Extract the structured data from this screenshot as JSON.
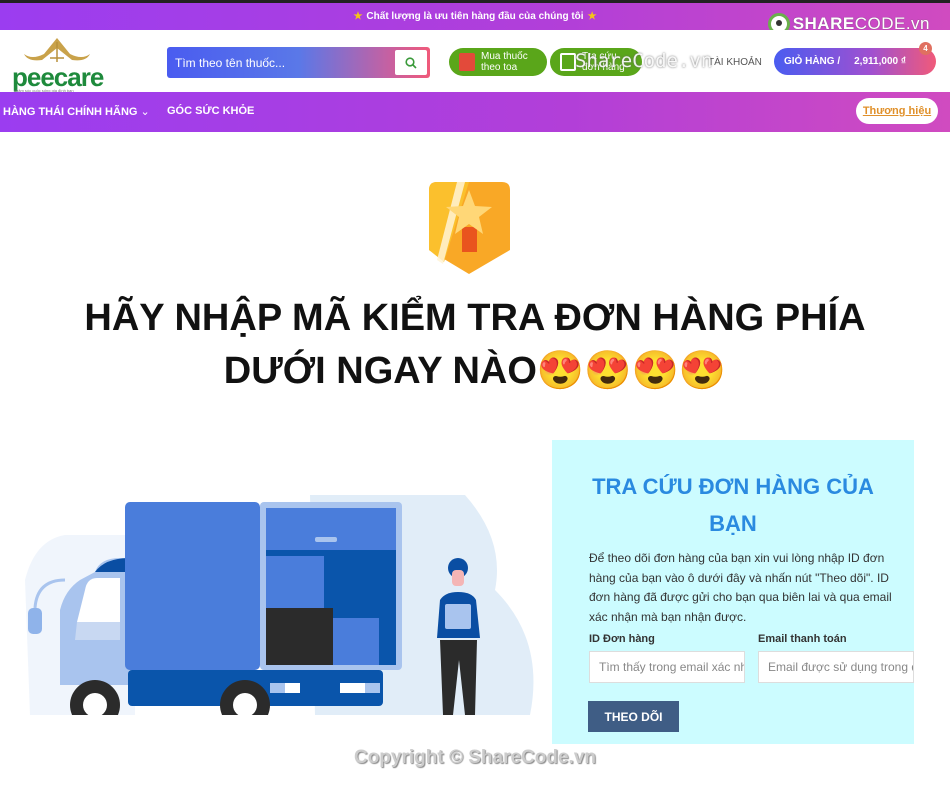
{
  "topbar": {
    "text": "Chất lượng là ưu tiên hàng đầu của chúng tôi"
  },
  "watermark": {
    "logo_text_bold": "SHARE",
    "logo_text_light": "CODE.vn",
    "center": "ShareCode.vn",
    "copyright": "Copyright © ShareCode.vn"
  },
  "header": {
    "logo_name": "peecare",
    "logo_tagline": "chăm sóc cuộc sống gia đình bạn",
    "search_placeholder": "Tìm theo tên thuốc...",
    "pill_prescription": [
      "Mua thuốc",
      "theo toa"
    ],
    "pill_lookup": [
      "Tra cứu",
      "đơn hàng"
    ],
    "account": "TÀI KHOẢN",
    "cart_label": "GIỎ HÀNG /",
    "cart_amount": "2,911,000 ₫",
    "cart_count": "4"
  },
  "nav": {
    "items": [
      {
        "label": "HÀNG THÁI CHÍNH HÃNG"
      },
      {
        "label": "GÓC SỨC KHỎE"
      }
    ],
    "brand_button": "Thương hiệu"
  },
  "main": {
    "headline_line1": "HÃY NHẬP MÃ KIỂM TRA ĐƠN HÀNG PHÍA",
    "headline_line2": "DƯỚI NGAY NÀO",
    "emojis": "😍😍😍😍"
  },
  "tracking": {
    "title": "TRA CỨU ĐƠN HÀNG CỦA BẠN",
    "description": "Để theo dõi đơn hàng của bạn xin vui lòng nhập ID đơn hàng của bạn vào ô dưới đây và nhấn nút \"Theo dõi\". ID đơn hàng đã được gửi cho bạn qua biên lai và qua email xác nhận mà bạn nhận được.",
    "order_id_label": "ID Đơn hàng",
    "order_id_placeholder": "Tìm thấy trong email xác nhận đơn hàng.",
    "email_label": "Email thanh toán",
    "email_placeholder": "Email được sử dụng trong quá trình thanh toán.",
    "submit": "THEO DÕI"
  }
}
